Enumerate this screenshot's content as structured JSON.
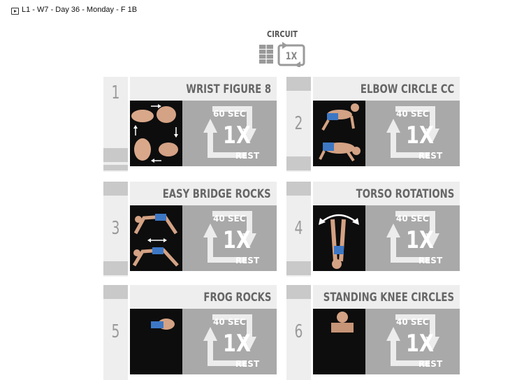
{
  "header": {
    "title": "L1 - W7 - Day 36 - Monday - F 1B"
  },
  "circuit": {
    "label": "CIRCUIT",
    "rounds": "1X"
  },
  "exercises": [
    {
      "number": "1",
      "name": "WRIST FIGURE 8",
      "duration": "60 SEC",
      "reps": "1X",
      "rest": "REST"
    },
    {
      "number": "2",
      "name": "ELBOW CIRCLE CC",
      "duration": "40 SEC",
      "reps": "1X",
      "rest": "REST"
    },
    {
      "number": "3",
      "name": "EASY BRIDGE ROCKS",
      "duration": "40 SEC",
      "reps": "1X",
      "rest": "REST"
    },
    {
      "number": "4",
      "name": "TORSO ROTATIONS",
      "duration": "40 SEC",
      "reps": "1X",
      "rest": "REST"
    },
    {
      "number": "5",
      "name": "FROG ROCKS",
      "duration": "40 SEC",
      "reps": "1X",
      "rest": "REST"
    },
    {
      "number": "6",
      "name": "STANDING KNEE CIRCLES",
      "duration": "40 SEC",
      "reps": "1X",
      "rest": "REST"
    }
  ],
  "colors": {
    "panel": "#a9a9a9",
    "card_bg": "#eeeeee",
    "tab": "#c9c9c9",
    "text_gray": "#666666"
  }
}
